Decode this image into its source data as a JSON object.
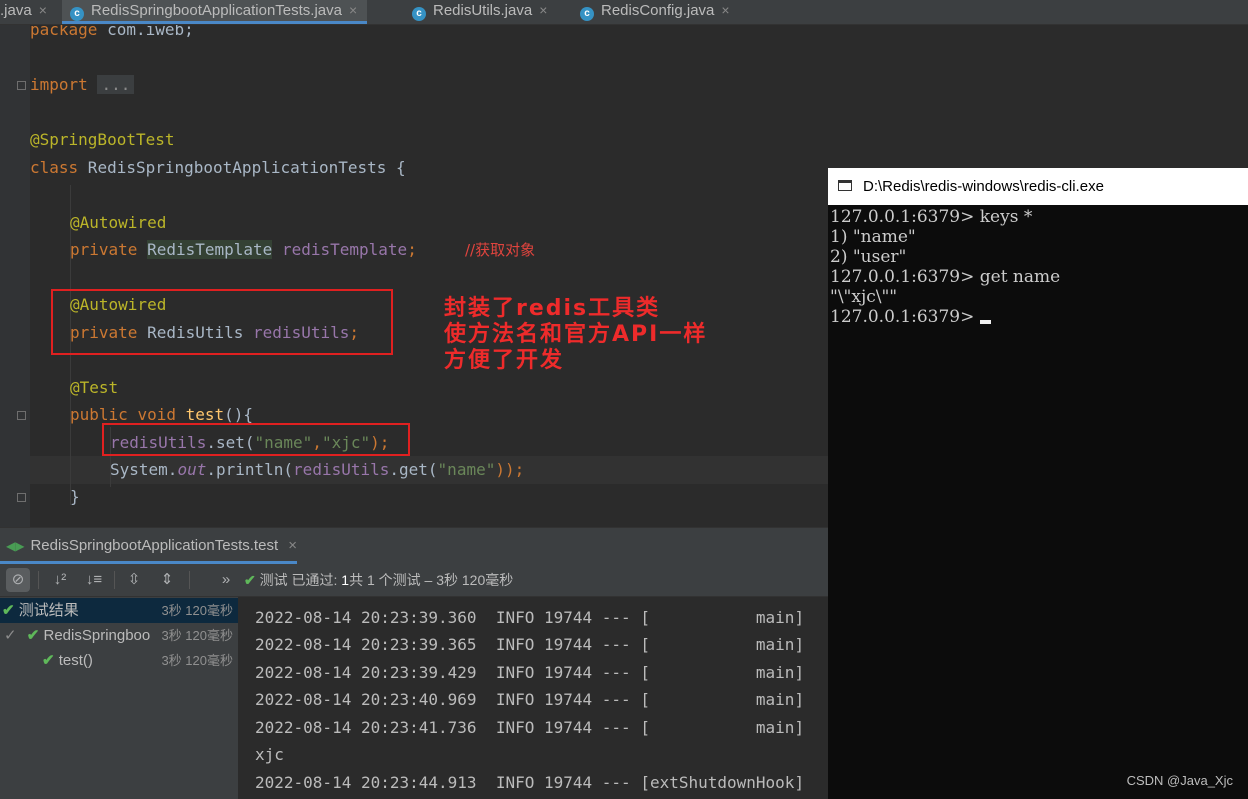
{
  "tabs": [
    {
      "label": ".java",
      "icon": "none",
      "close": "×"
    },
    {
      "label": "RedisSpringbootApplicationTests.java",
      "icon": "java-class-icon",
      "close": "×"
    },
    {
      "label": "RedisUtils.java",
      "icon": "java-class-icon",
      "close": "×"
    },
    {
      "label": "RedisConfig.java",
      "icon": "java-class-icon",
      "close": "×"
    }
  ],
  "editor": {
    "package_kw": "package",
    "package_name": " com.iweb;",
    "import_kw": "import",
    "import_fold": "...",
    "class_annotation": "@SpringBootTest",
    "class_kw": "class",
    "class_name": " RedisSpringbootApplicationTests {",
    "autowired_1": "@Autowired",
    "private_kw": "private",
    "field1_type": "RedisTemplate",
    "field1_name": "redisTemplate",
    "semicolon": ";",
    "field1_comment": "//获取对象",
    "autowired_2": "@Autowired",
    "field2_type": " RedisUtils ",
    "field2_name": "redisUtils",
    "test_annotation": "@Test",
    "public_kw": "public",
    "void_kw": "void",
    "method_name": "test",
    "method_open": "(){",
    "call1_obj": "redisUtils",
    "call1_method": ".set(",
    "call1_arg1": "\"name\"",
    "comma": ",",
    "call1_arg2": "\"xjc\"",
    "call1_close": ");",
    "call2_system": "System.",
    "call2_out": "out",
    "call2_println": ".println(",
    "call2_obj": "redisUtils",
    "call2_get": ".get(",
    "call2_arg": "\"name\"",
    "call2_close": "));",
    "close_brace": "}"
  },
  "annotation_note": [
    "封装了redis工具类",
    "使方法名和官方API一样",
    "方便了开发"
  ],
  "run_panel": {
    "tab_label": "RedisSpringbootApplicationTests.test",
    "tab_close": "×",
    "status_prefix": "测试 已通过: ",
    "status_count": "1",
    "status_suffix": "共 1 个测试 – 3秒 120毫秒",
    "more": "»"
  },
  "tree": [
    {
      "label": "测试结果",
      "time": "3秒 120毫秒"
    },
    {
      "label": "RedisSpringboo",
      "time": "3秒 120毫秒"
    },
    {
      "label": "test()",
      "time": "3秒 120毫秒"
    }
  ],
  "console_lines": [
    "2022-08-14 20:23:39.360  INFO 19744 --- [           main]",
    "2022-08-14 20:23:39.365  INFO 19744 --- [           main]",
    "2022-08-14 20:23:39.429  INFO 19744 --- [           main]",
    "2022-08-14 20:23:40.969  INFO 19744 --- [           main]",
    "2022-08-14 20:23:41.736  INFO 19744 --- [           main]",
    "xjc",
    "2022-08-14 20:23:44.913  INFO 19744 --- [extShutdownHook]"
  ],
  "cmd": {
    "title": "D:\\Redis\\redis-windows\\redis-cli.exe",
    "lines": [
      "127.0.0.1:6379> keys *",
      "1) \"name\"",
      "2) \"user\"",
      "127.0.0.1:6379> get name",
      "\"\\\"xjc\\\"\"",
      "127.0.0.1:6379> "
    ]
  },
  "watermark": "CSDN @Java_Xjc",
  "colors": {
    "editor_bg": "#2b2b2b",
    "keyword": "#cc7832",
    "annotation": "#bbb529",
    "string": "#6a8759",
    "field": "#9876aa",
    "method": "#ffc66d",
    "red_highlight": "#e02020",
    "pass_green": "#5fb85a",
    "cmd_bg": "#0c0c0c"
  }
}
